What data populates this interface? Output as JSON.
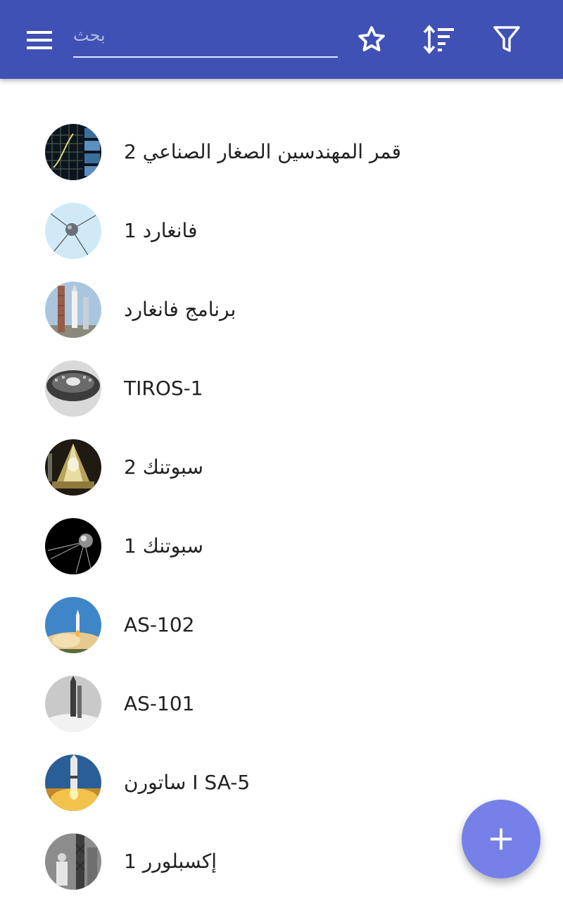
{
  "toolbar": {
    "background_color": "#3f51b5",
    "search": {
      "placeholder": "بحث",
      "value": ""
    },
    "icons": {
      "menu": "menu-icon",
      "favorites": "star-outline-icon",
      "sort": "sort-icon",
      "filter": "filter-icon"
    }
  },
  "list": {
    "items": [
      {
        "label": "قمر المهندسين الصغار الصناعي 2",
        "thumbnail": "satellite-graph-thumbnail"
      },
      {
        "label": "فانغارد 1",
        "thumbnail": "vanguard-satellite-thumbnail"
      },
      {
        "label": "برنامج فانغارد",
        "thumbnail": "launch-tower-thumbnail"
      },
      {
        "label": "TIROS-1",
        "thumbnail": "tiros-satellite-thumbnail"
      },
      {
        "label": "سبوتنك 2",
        "thumbnail": "sputnik2-thumbnail"
      },
      {
        "label": "سبوتنك 1",
        "thumbnail": "sputnik1-thumbnail"
      },
      {
        "label": "AS-102",
        "thumbnail": "rocket-launch-sky-thumbnail"
      },
      {
        "label": "AS-101",
        "thumbnail": "rocket-launch-bw-thumbnail"
      },
      {
        "label": "ساتورن I SA-5",
        "thumbnail": "saturn-launch-thumbnail"
      },
      {
        "label": "إكسبلورر 1",
        "thumbnail": "explorer-bw-thumbnail"
      }
    ]
  },
  "fab": {
    "icon": "plus-icon",
    "color": "#7581e8"
  }
}
